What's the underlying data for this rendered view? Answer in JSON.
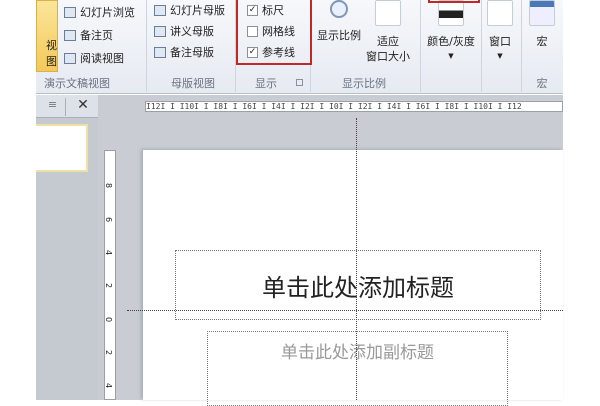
{
  "ribbon": {
    "normal_view_label": "视图",
    "presentation_views": {
      "items": [
        "幻灯片浏览",
        "备注页",
        "阅读视图"
      ],
      "group_label": "演示文稿视图"
    },
    "master_views": {
      "items": [
        "幻灯片母版",
        "讲义母版",
        "备注母版"
      ],
      "group_label": "母版视图"
    },
    "show": {
      "items": [
        {
          "label": "标尺",
          "checked": true
        },
        {
          "label": "网格线",
          "checked": false
        },
        {
          "label": "参考线",
          "checked": true
        }
      ],
      "group_label": "显示"
    },
    "zoom": {
      "zoom_label": "显示比例",
      "fit_label_1": "适应",
      "fit_label_2": "窗口大小",
      "group_label": "显示比例"
    },
    "color": {
      "label": "颜色/灰度"
    },
    "window": {
      "label": "窗口"
    },
    "macro": {
      "label": "宏",
      "group_label": "宏"
    }
  },
  "ruler": {
    "horizontal": "I12I I I10I I I8I I I6I I I4I I I2I I I0I I I2I I I4I I I6I I I8I I I10I I I12",
    "vertical": [
      "8",
      "6",
      "4",
      "2",
      "0",
      "2",
      "4"
    ]
  },
  "slide": {
    "title_placeholder": "单击此处添加标题",
    "subtitle_placeholder": "单击此处添加副标题"
  },
  "colors": {
    "highlight_red": "#c0282a",
    "active_view": "#f7d46a"
  }
}
